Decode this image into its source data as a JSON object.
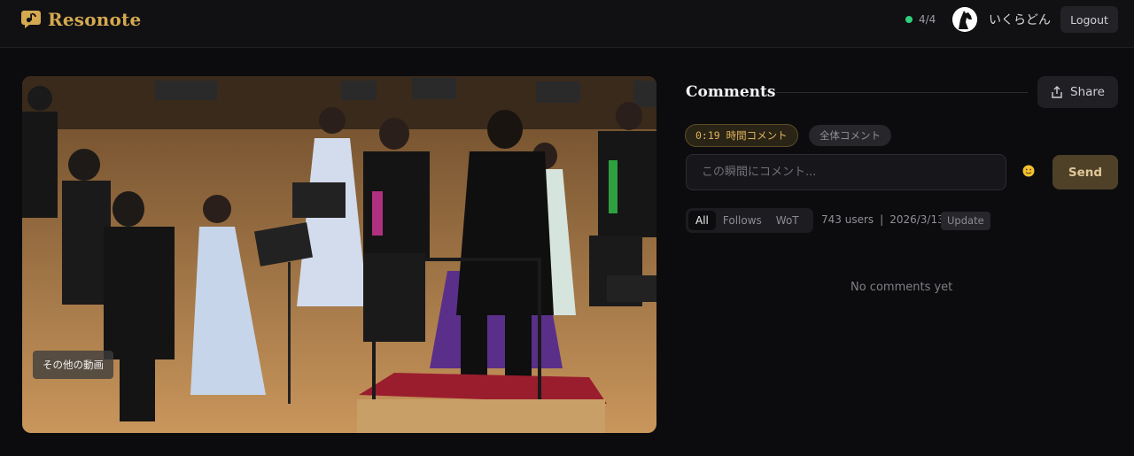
{
  "app": {
    "name": "Resonote"
  },
  "header": {
    "status_count": "4/4",
    "username": "いくらどん",
    "logout_label": "Logout"
  },
  "video": {
    "more_videos_label": "その他の動画"
  },
  "comments": {
    "title": "Comments",
    "share_label": "Share",
    "time_chip": "0:19 時間コメント",
    "all_chip": "全体コメント",
    "input_placeholder": "この瞬間にコメント...",
    "input_value": "",
    "send_label": "Send",
    "filters": [
      "All",
      "Follows",
      "WoT"
    ],
    "active_filter": "All",
    "users_count": "743 users",
    "separator": "|",
    "date": "2026/3/13",
    "update_label": "Update",
    "empty_message": "No comments yet"
  },
  "colors": {
    "accent_gold": "#d4a94f",
    "status_green": "#2fd17b",
    "background": "#0c0c0e"
  },
  "icons": [
    "music-note-icon",
    "share-icon",
    "emoji-icon",
    "horse-avatar-icon"
  ]
}
